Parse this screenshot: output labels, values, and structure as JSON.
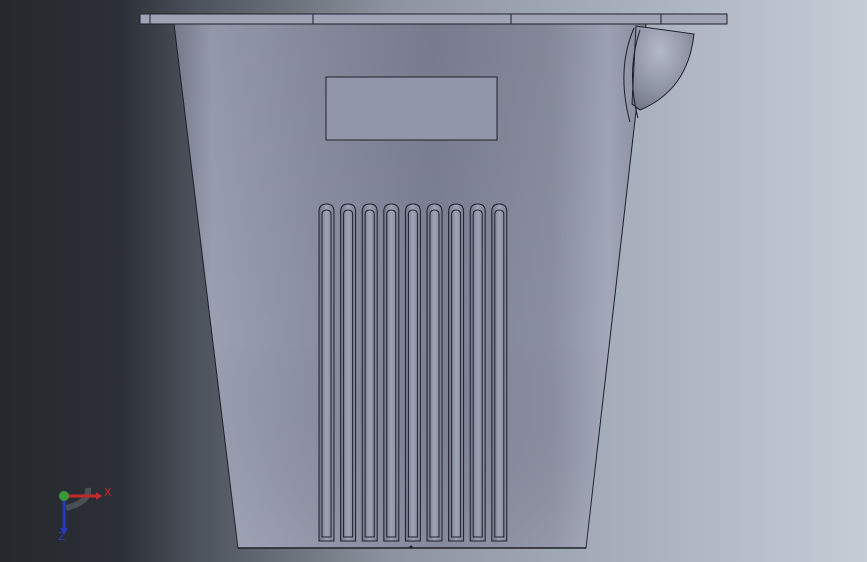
{
  "viewport": {
    "background_colors": [
      "#25282c",
      "#8d949f",
      "#c6ccd6"
    ],
    "model_color": "#8a8fa0"
  },
  "model": {
    "description_icon": "tapered-basket-part",
    "slot_count": 9,
    "has_top_flange": true,
    "has_side_knob": true,
    "has_label_recess": true
  },
  "triad": {
    "x_label": "X",
    "y_label": "Y",
    "z_label": "Z",
    "x_color": "#c0282a",
    "y_color": "#3a9a3a",
    "z_color": "#2438c0"
  }
}
